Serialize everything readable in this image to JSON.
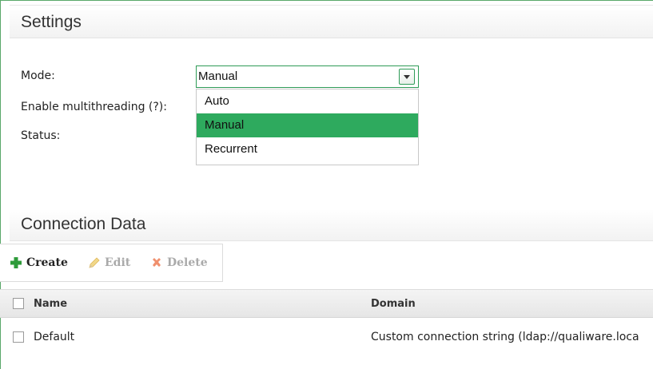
{
  "settings": {
    "title": "Settings",
    "mode_label": "Mode:",
    "multithreading_label": "Enable multithreading (?):",
    "status_label": "Status:",
    "mode_select": {
      "value": "Manual",
      "options": [
        "Auto",
        "Manual",
        "Recurrent"
      ],
      "selected_index": 1
    }
  },
  "connection": {
    "title": "Connection Data",
    "toolbar": {
      "create_label": "Create",
      "edit_label": "Edit",
      "delete_label": "Delete"
    },
    "columns": [
      "Name",
      "Domain"
    ],
    "rows": [
      {
        "name": "Default",
        "domain": "Custom connection string (ldap://qualiware.loca"
      }
    ]
  },
  "colors": {
    "accent": "#2eaa5e",
    "create_icon": "#2e9b3a",
    "delete_icon": "#e8734a",
    "edit_icon": "#e9c76b"
  },
  "icons": {
    "create": "plus-icon",
    "edit": "pencil-icon",
    "delete": "x-icon",
    "dropdown": "chevron-down-icon"
  }
}
